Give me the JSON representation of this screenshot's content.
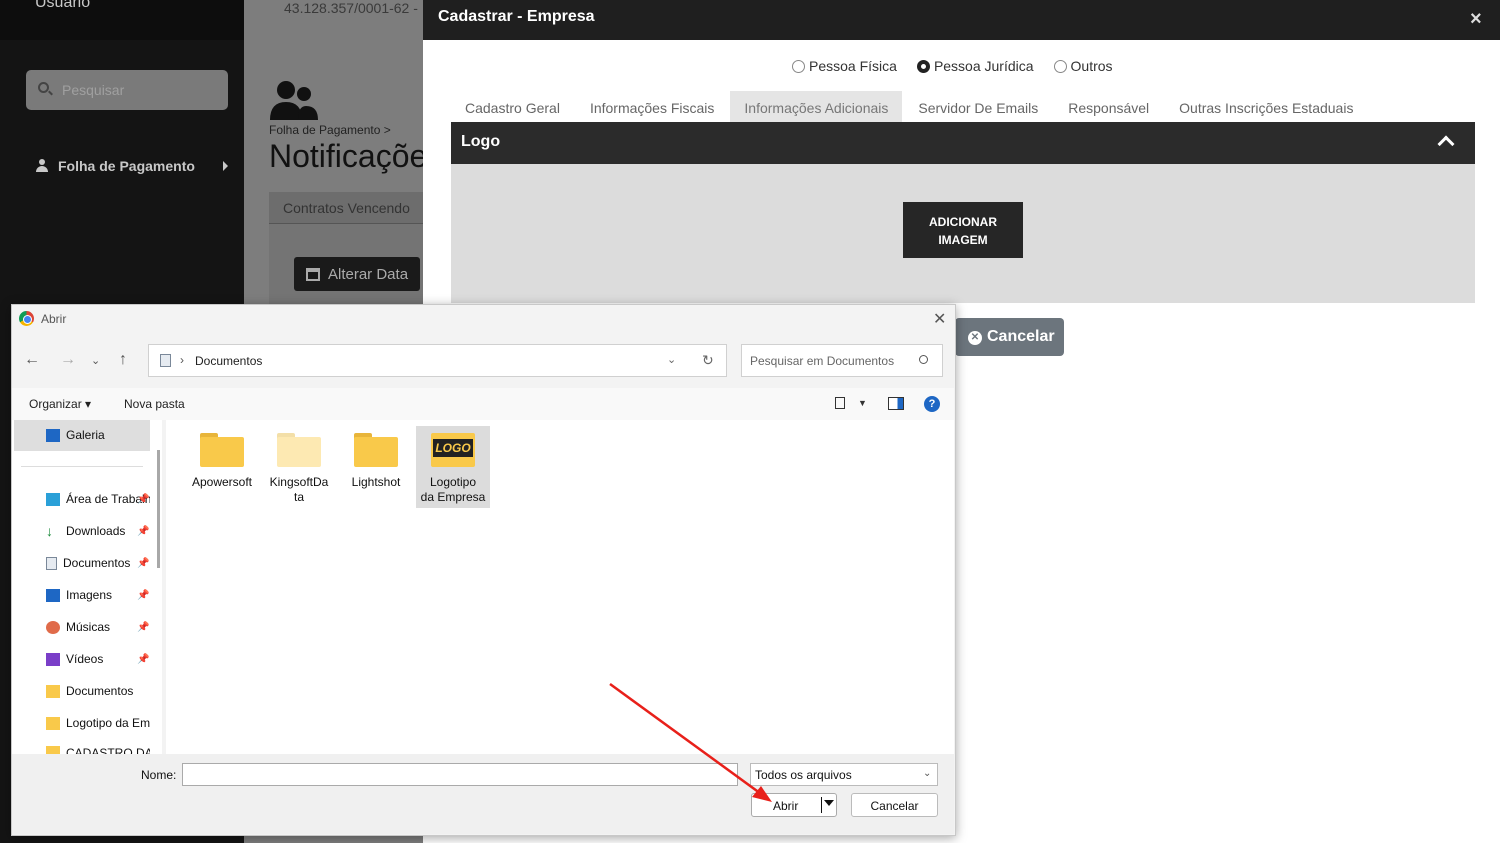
{
  "background": {
    "sidebar": {
      "user_label": "Usuário",
      "search_placeholder": "Pesquisar",
      "menu_item": "Folha de Pagamento"
    },
    "cnpj_fragment": "43.128.357/0001-62 -",
    "breadcrumb": "Folha de Pagamento  >",
    "page_title": "Notificaçõe",
    "tab": "Contratos Vencendo",
    "button": "Alterar Data"
  },
  "modal": {
    "title": "Cadastrar - Empresa",
    "close": "×",
    "radios": [
      {
        "label": "Pessoa Física",
        "selected": false
      },
      {
        "label": "Pessoa Jurídica",
        "selected": true
      },
      {
        "label": "Outros",
        "selected": false
      }
    ],
    "tabs": [
      {
        "label": "Cadastro Geral"
      },
      {
        "label": "Informações Fiscais"
      },
      {
        "label": "Informações Adicionais",
        "active": true
      },
      {
        "label": "Servidor De Emails"
      },
      {
        "label": "Responsável"
      },
      {
        "label": "Outras Inscrições Estaduais"
      }
    ],
    "section_title": "Logo",
    "add_image_line1": "ADICIONAR",
    "add_image_line2": "IMAGEM",
    "cancel": "Cancelar"
  },
  "dialog": {
    "title": "Abrir",
    "close": "✕",
    "address": "Documentos",
    "search_placeholder": "Pesquisar em Documentos",
    "organize": "Organizar ▾",
    "new_folder": "Nova pasta",
    "help": "?",
    "nav": {
      "galeria": "Galeria",
      "items": [
        "Área de Trabalho",
        "Downloads",
        "Documentos",
        "Imagens",
        "Músicas",
        "Vídeos",
        "Documentos",
        "Logotipo da Empresa",
        "CADASTRO DA"
      ]
    },
    "files": [
      {
        "name": "Apowersoft"
      },
      {
        "name": "KingsoftData",
        "line1": "KingsoftDa",
        "line2": "ta"
      },
      {
        "name": "Lightshot"
      },
      {
        "name": "Logotipo da Empresa",
        "line1": "Logotipo",
        "line2": "da Empresa",
        "thumb": "LOGO"
      }
    ],
    "name_label": "Nome:",
    "name_value": "",
    "file_type": "Todos os arquivos",
    "open": "Abrir",
    "cancel": "Cancelar"
  },
  "colors": {
    "annotation_arrow": "#e8201a",
    "accent_blue": "#1e67c4"
  }
}
